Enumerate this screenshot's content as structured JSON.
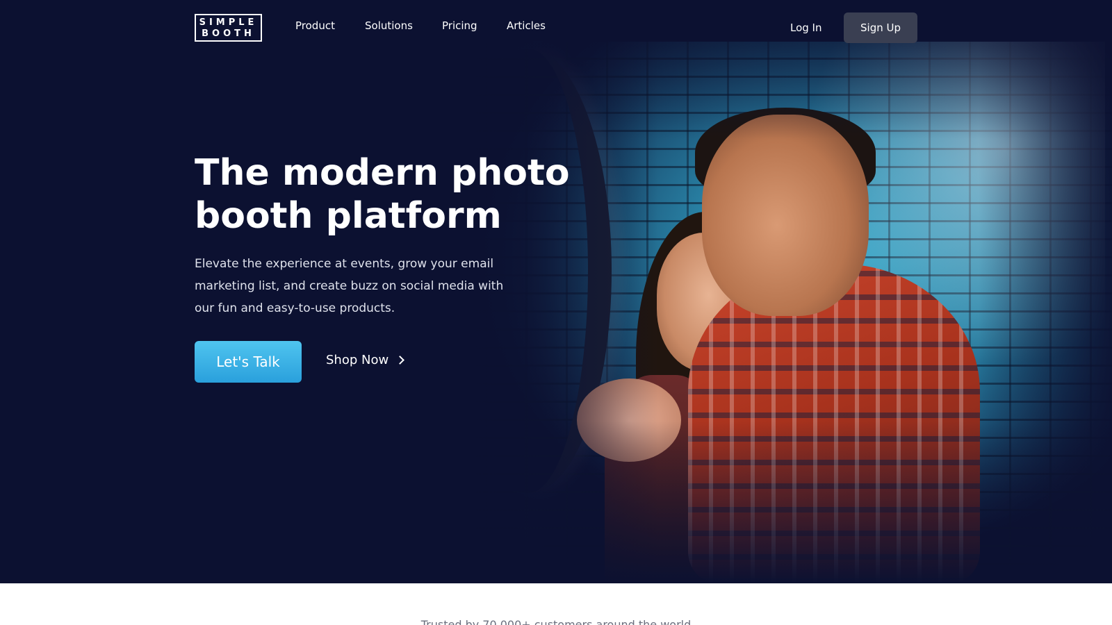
{
  "logo": {
    "line1": "SIMPLE",
    "line2": "BOOTH"
  },
  "nav": {
    "items": [
      {
        "label": "Product"
      },
      {
        "label": "Solutions"
      },
      {
        "label": "Pricing"
      },
      {
        "label": "Articles"
      }
    ],
    "login_label": "Log In",
    "signup_label": "Sign Up"
  },
  "hero": {
    "headline": "The modern photo booth platform",
    "description": "Elevate the experience at events, grow your email marketing list, and create buzz on social media with our fun and easy-to-use products.",
    "primary_cta": "Let's Talk",
    "secondary_cta": "Shop Now"
  },
  "trusted": {
    "text": "Trusted by 70,000+ customers around the world"
  },
  "colors": {
    "hero_background": "#0c1131",
    "primary_cta": "#38b0e6",
    "signup_button": "#3a3f52"
  }
}
